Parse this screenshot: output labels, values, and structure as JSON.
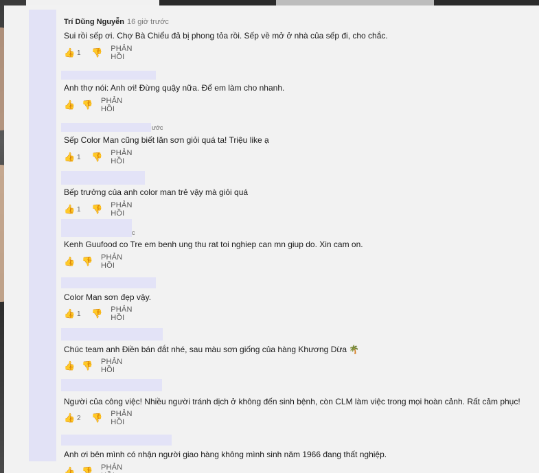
{
  "comments": [
    {
      "author": "Trí Dũng Nguyễn",
      "time": "16 giờ trước",
      "text": "Sui rồi sếp ơi. Chợ Bà Chiểu đả bị phong tỏa rồi. Sếp về mở ở nhà của sếp đi, cho chắc.",
      "likes": "1",
      "reply": "PHẢN HỒI"
    },
    {
      "author": "",
      "time": "",
      "text": "Anh thợ nói: Anh ơi! Đừng quậy nữa. Để em làm cho nhanh.",
      "likes": "",
      "reply": "PHẢN HỒI"
    },
    {
      "author": "",
      "time": "ước",
      "text": "Sếp Color Man cũng biết lăn sơn giỏi quá ta! Triệu like ạ",
      "likes": "1",
      "reply": "PHẢN HỒI"
    },
    {
      "author": "",
      "time": "",
      "text": "Bếp trưởng của anh color man trẻ vậy mà giỏi quá",
      "likes": "1",
      "reply": "PHẢN HỒI"
    },
    {
      "author": "",
      "time": "c",
      "text": "Kenh Guufood co Tre em benh ung thu rat toi nghiep can mn giup do.  Xin cam on.",
      "likes": "",
      "reply": "PHẢN HỒI"
    },
    {
      "author": "",
      "time": "",
      "text": "Color Man sơn đẹp vậy.",
      "likes": "1",
      "reply": "PHẢN HỒI"
    },
    {
      "author": "",
      "time": "",
      "text": "Chúc team anh Điền bán đắt nhé, sau màu sơn giống của hàng Khương Dừa 🌴",
      "likes": "",
      "reply": "PHẢN HỒI"
    },
    {
      "author": "",
      "time": "",
      "text": "Người của công việc! Nhiều người tránh dịch ở không đến sinh bệnh, còn CLM làm việc trong mọi hoàn cảnh. Rất cảm phục!",
      "likes": "2",
      "reply": "PHẢN HỒI"
    },
    {
      "author": "",
      "time": "",
      "text": "Anh ơi bên mình có nhận người giao hàng không mình sinh năm 1966 đang thất nghiệp.",
      "likes": "",
      "reply": "PHẢN HỒI"
    }
  ],
  "icons": {
    "like": "thumbs-up-icon",
    "dislike": "thumbs-down-icon"
  }
}
